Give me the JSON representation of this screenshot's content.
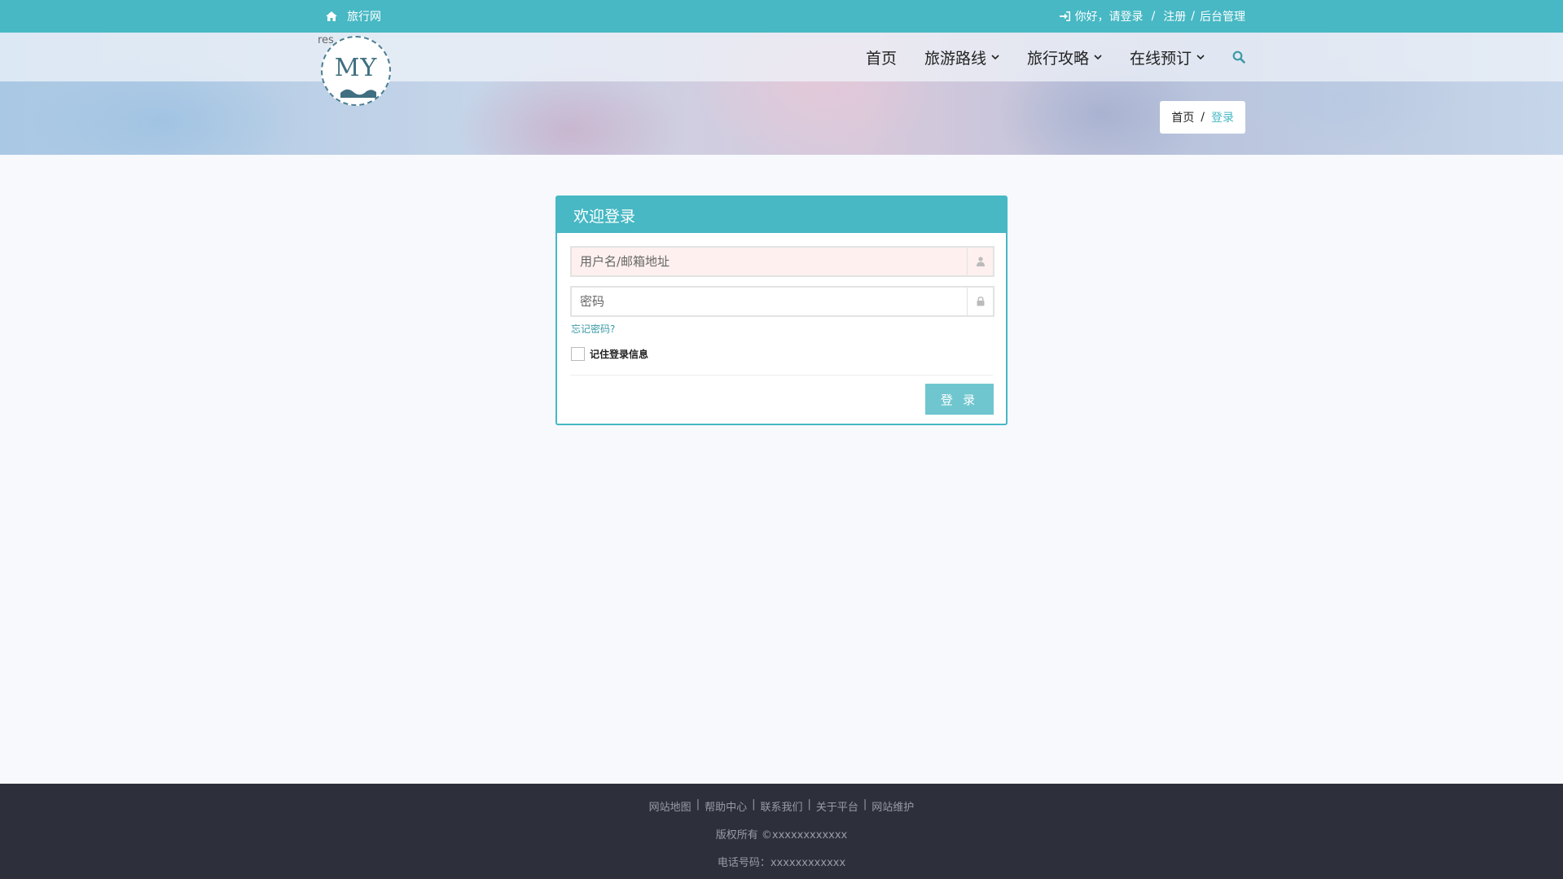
{
  "topbar": {
    "site_name": "旅行网",
    "login_text": "你好，请登录",
    "register": "注册",
    "sep": "/",
    "admin": "后台管理"
  },
  "logo": {
    "text": "MY",
    "res_text": "res"
  },
  "nav": {
    "home": "首页",
    "routes": "旅游路线",
    "guides": "旅行攻略",
    "booking": "在线预订"
  },
  "breadcrumb": {
    "home": "首页",
    "sep": "/",
    "current": "登录"
  },
  "login": {
    "title": "欢迎登录",
    "username_placeholder": "用户名/邮箱地址",
    "password_placeholder": "密码",
    "forgot": "忘记密码?",
    "remember": "记住登录信息",
    "submit": "登 录"
  },
  "footer": {
    "links": [
      "网站地图",
      "帮助中心",
      "联系我们",
      "关于平台",
      "网站维护"
    ],
    "copyright": "版权所有 ©xxxxxxxxxxxx",
    "phone": "电话号码：xxxxxxxxxxxx"
  },
  "colors": {
    "accent": "#47b8c4",
    "footer_bg": "#2d2f3b",
    "button": "#6fc6cf"
  }
}
